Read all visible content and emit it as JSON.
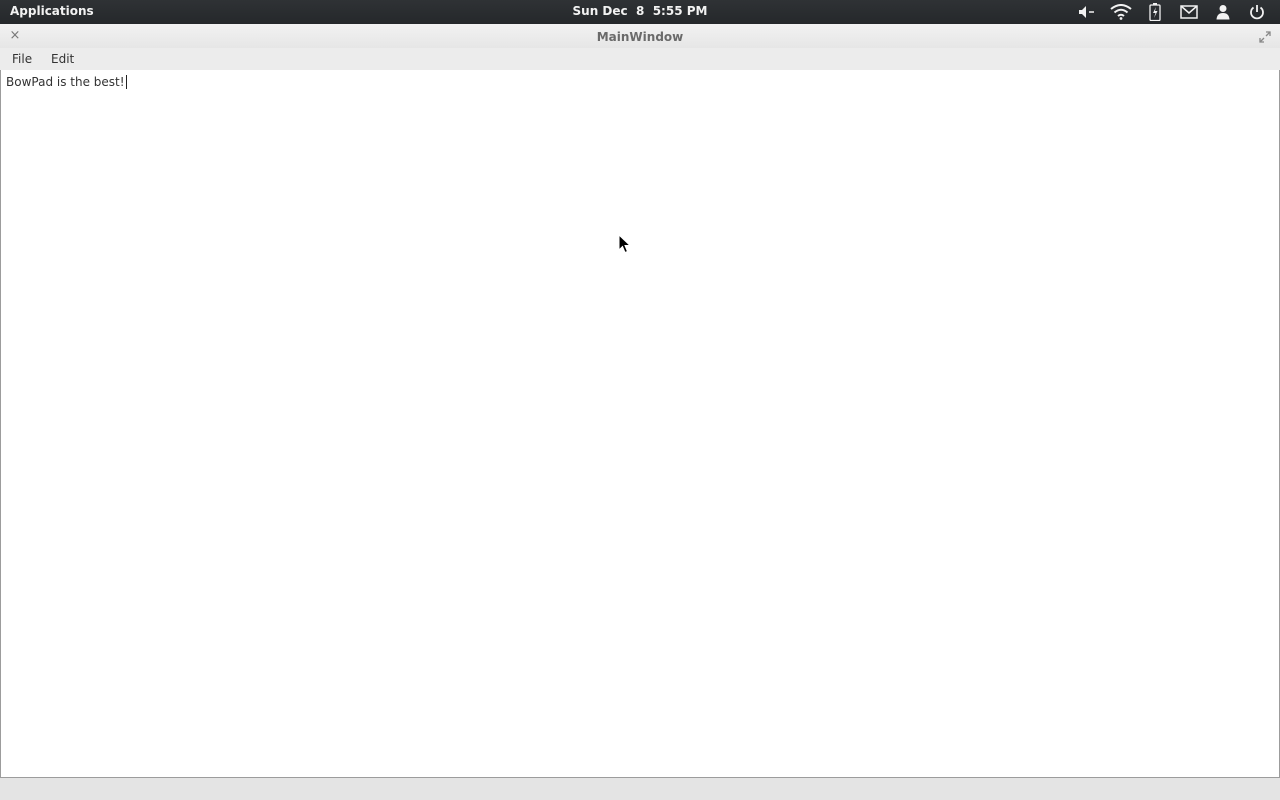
{
  "top_panel": {
    "applications_label": "Applications",
    "clock": "Sun Dec  8  5:55 PM",
    "indicators": [
      "volume-muted-icon",
      "wifi-icon",
      "battery-icon",
      "mail-icon",
      "user-icon",
      "power-icon"
    ]
  },
  "window": {
    "title": "MainWindow",
    "close_glyph": "×",
    "menu": {
      "file_label": "File",
      "edit_label": "Edit"
    },
    "editor": {
      "text": "BowPad is the best!"
    }
  },
  "colors": {
    "panel": "#2b2f33",
    "window_bg": "#e8e8e8",
    "editor_bg": "#ffffff"
  }
}
